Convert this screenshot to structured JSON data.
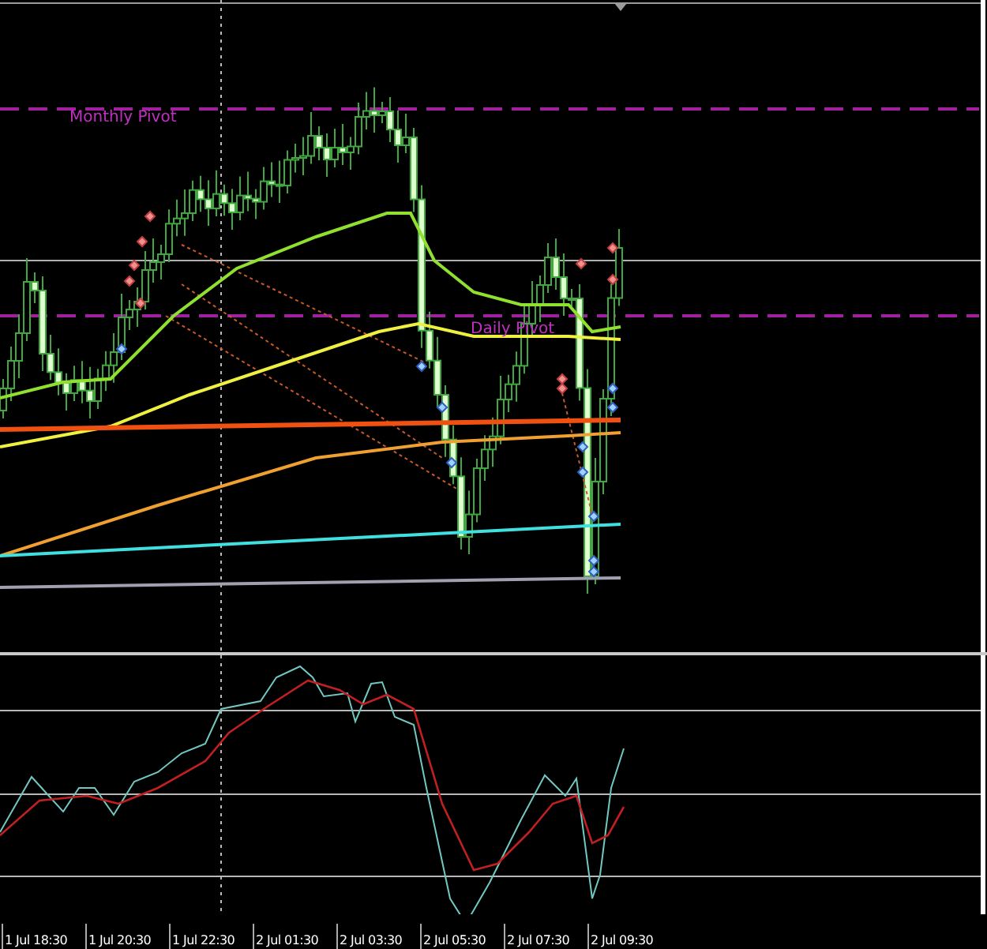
{
  "price_chart": {
    "pivot_labels": [
      {
        "kind": "monthly",
        "text": "Monthly Pivot"
      },
      {
        "kind": "daily",
        "text": "Daily Pivot"
      }
    ]
  },
  "time_axis": {
    "labels": [
      "1 Jul 18:30",
      "1 Jul 20:30",
      "1 Jul 22:30",
      "2 Jul 01:30",
      "2 Jul 03:30",
      "2 Jul 05:30",
      "2 Jul 07:30",
      "2 Jul 09:30"
    ]
  }
}
